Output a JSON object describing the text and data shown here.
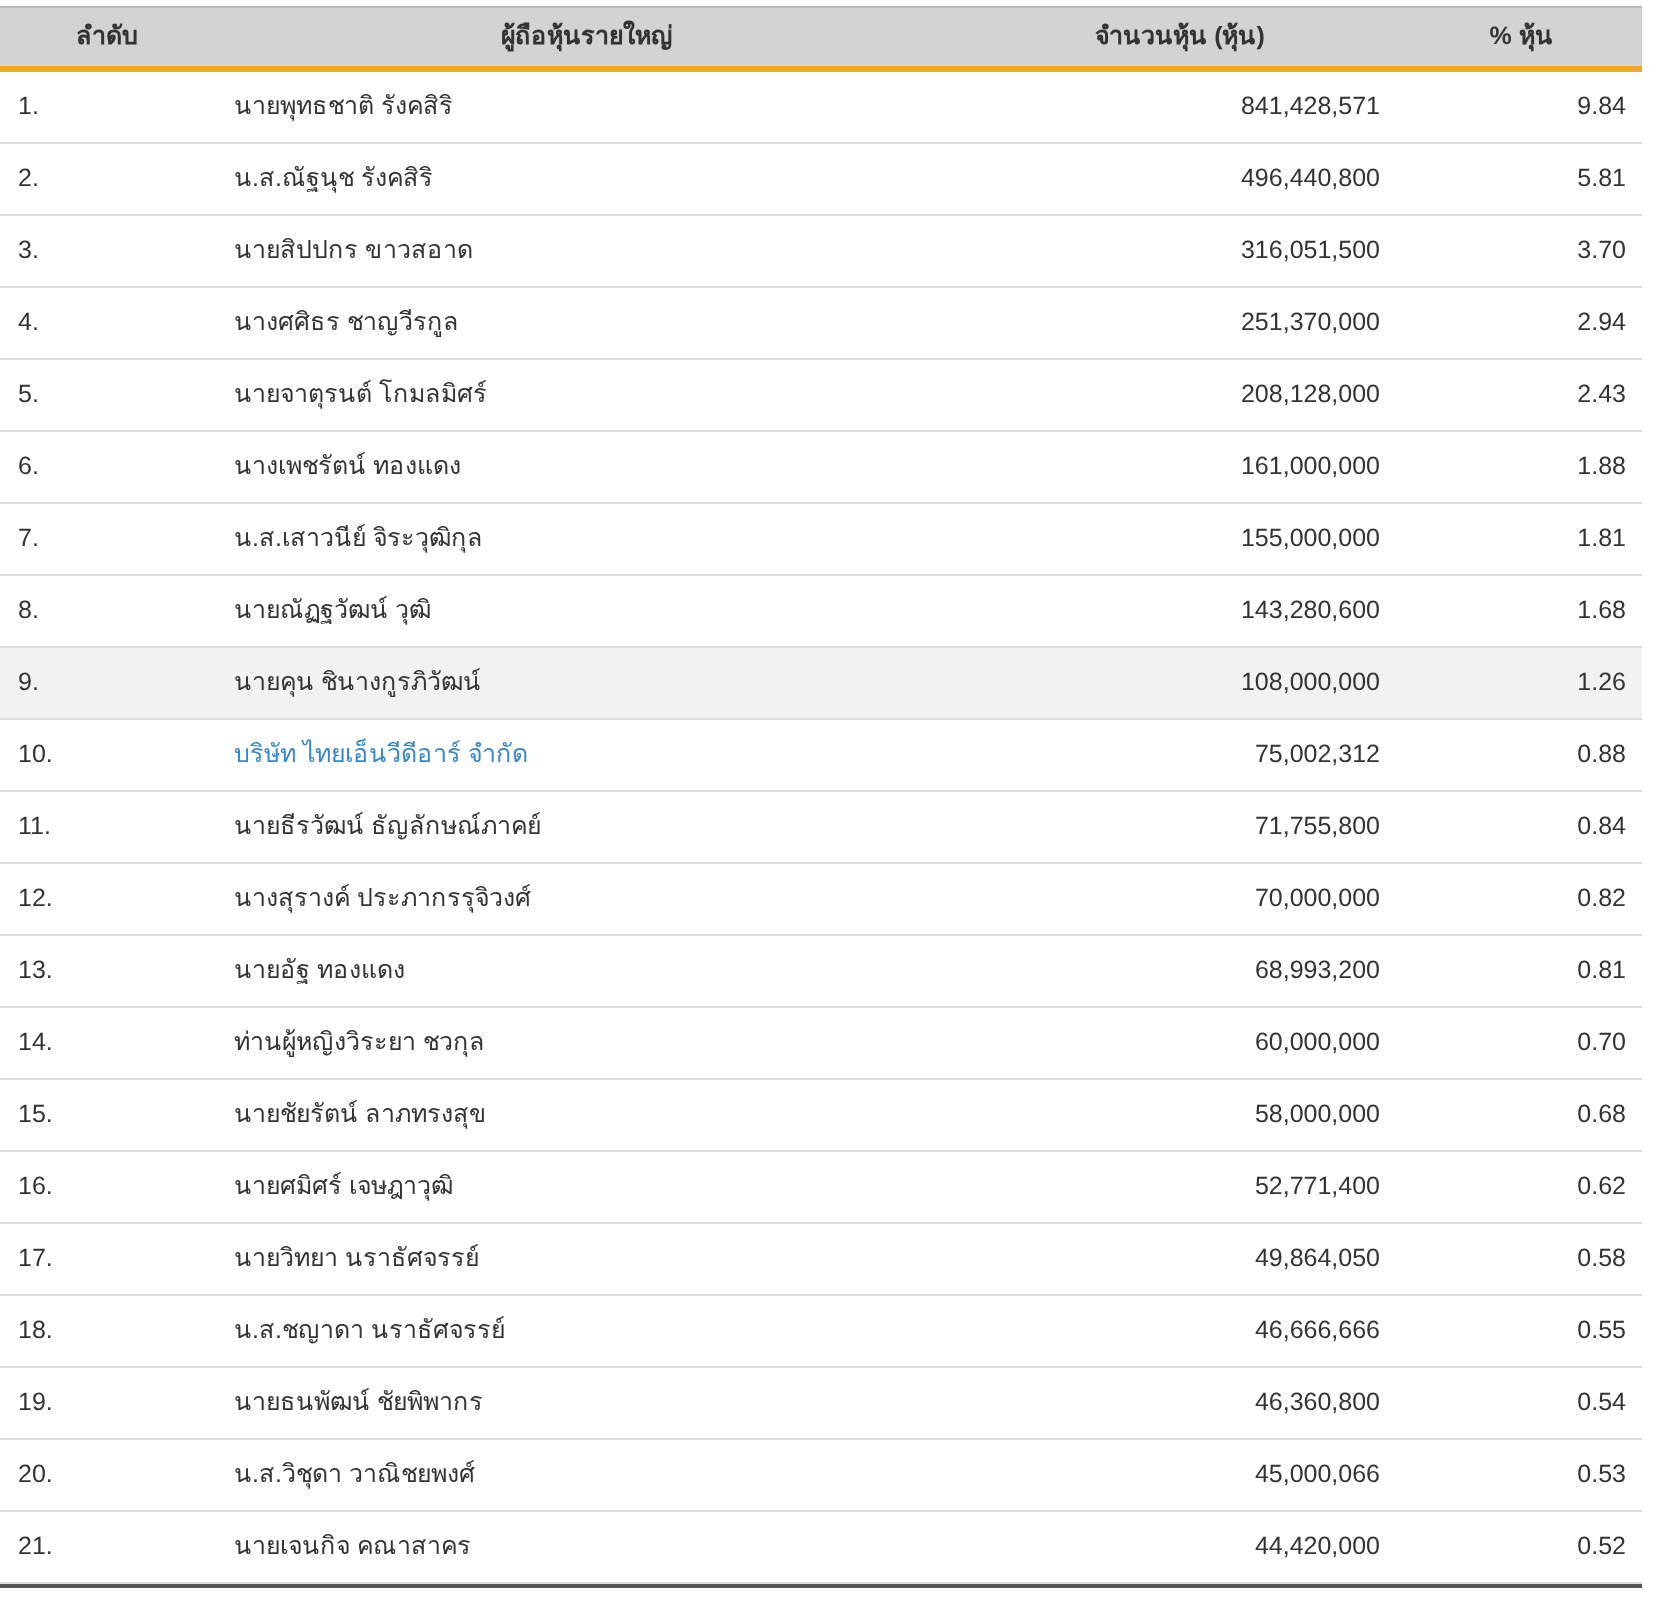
{
  "table": {
    "columns": [
      "ลำดับ",
      "ผู้ถือหุ้นรายใหญ่",
      "จำนวนหุ้น (หุ้น)",
      "% หุ้น"
    ],
    "rows": [
      {
        "rank": "1.",
        "name": "นายพุทธชาติ รังคสิริ",
        "shares": "841,428,571",
        "percent": "9.84",
        "linked": false,
        "highlighted": false
      },
      {
        "rank": "2.",
        "name": "น.ส.ณัฐนุช รังคสิริ",
        "shares": "496,440,800",
        "percent": "5.81",
        "linked": false,
        "highlighted": false
      },
      {
        "rank": "3.",
        "name": "นายสิปปกร ขาวสอาด",
        "shares": "316,051,500",
        "percent": "3.70",
        "linked": false,
        "highlighted": false
      },
      {
        "rank": "4.",
        "name": "นางศศิธร ชาญวีรกูล",
        "shares": "251,370,000",
        "percent": "2.94",
        "linked": false,
        "highlighted": false
      },
      {
        "rank": "5.",
        "name": "นายจาตุรนต์ โกมลมิศร์",
        "shares": "208,128,000",
        "percent": "2.43",
        "linked": false,
        "highlighted": false
      },
      {
        "rank": "6.",
        "name": "นางเพชรัตน์ ทองแดง",
        "shares": "161,000,000",
        "percent": "1.88",
        "linked": false,
        "highlighted": false
      },
      {
        "rank": "7.",
        "name": "น.ส.เสาวนีย์ จิระวุฒิกุล",
        "shares": "155,000,000",
        "percent": "1.81",
        "linked": false,
        "highlighted": false
      },
      {
        "rank": "8.",
        "name": "นายณัฏฐวัฒน์ วุฒิ",
        "shares": "143,280,600",
        "percent": "1.68",
        "linked": false,
        "highlighted": false
      },
      {
        "rank": "9.",
        "name": "นายคุน ชินางกูรภิวัฒน์",
        "shares": "108,000,000",
        "percent": "1.26",
        "linked": false,
        "highlighted": true
      },
      {
        "rank": "10.",
        "name": "บริษัท ไทยเอ็นวีดีอาร์ จำกัด",
        "shares": "75,002,312",
        "percent": "0.88",
        "linked": true,
        "highlighted": false
      },
      {
        "rank": "11.",
        "name": "นายธีรวัฒน์ ธัญลักษณ์ภาคย์",
        "shares": "71,755,800",
        "percent": "0.84",
        "linked": false,
        "highlighted": false
      },
      {
        "rank": "12.",
        "name": "นางสุรางค์ ประภากรรุจิวงศ์",
        "shares": "70,000,000",
        "percent": "0.82",
        "linked": false,
        "highlighted": false
      },
      {
        "rank": "13.",
        "name": "นายอัฐ ทองแดง",
        "shares": "68,993,200",
        "percent": "0.81",
        "linked": false,
        "highlighted": false
      },
      {
        "rank": "14.",
        "name": "ท่านผู้หญิงวิระยา ชวกุล",
        "shares": "60,000,000",
        "percent": "0.70",
        "linked": false,
        "highlighted": false
      },
      {
        "rank": "15.",
        "name": "นายชัยรัตน์ ลาภทรงสุข",
        "shares": "58,000,000",
        "percent": "0.68",
        "linked": false,
        "highlighted": false
      },
      {
        "rank": "16.",
        "name": "นายศมิศร์ เจษฎาวุฒิ",
        "shares": "52,771,400",
        "percent": "0.62",
        "linked": false,
        "highlighted": false
      },
      {
        "rank": "17.",
        "name": "นายวิทยา นราธัศจรรย์",
        "shares": "49,864,050",
        "percent": "0.58",
        "linked": false,
        "highlighted": false
      },
      {
        "rank": "18.",
        "name": "น.ส.ชญาดา นราธัศจรรย์",
        "shares": "46,666,666",
        "percent": "0.55",
        "linked": false,
        "highlighted": false
      },
      {
        "rank": "19.",
        "name": "นายธนพัฒน์ ชัยพิพากร",
        "shares": "46,360,800",
        "percent": "0.54",
        "linked": false,
        "highlighted": false
      },
      {
        "rank": "20.",
        "name": "น.ส.วิชุดา วาณิชยพงศ์",
        "shares": "45,000,066",
        "percent": "0.53",
        "linked": false,
        "highlighted": false
      },
      {
        "rank": "21.",
        "name": "นายเจนกิจ คณาสาคร",
        "shares": "44,420,000",
        "percent": "0.52",
        "linked": false,
        "highlighted": false
      }
    ]
  }
}
